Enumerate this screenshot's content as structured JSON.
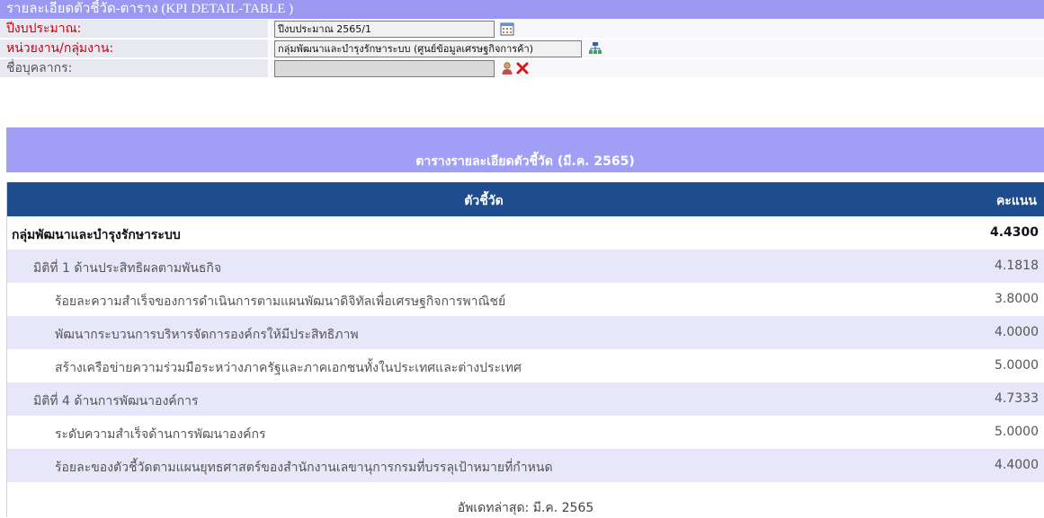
{
  "filter": {
    "title": "รายละเอียดตัวชี้วัด-ตาราง  (KPI DETAIL-TABLE )",
    "budget_year": {
      "label": "ปีงบประมาณ:",
      "value": "ปีงบประมาณ 2565/1",
      "icon": "calendar-icon"
    },
    "department": {
      "label": "หน่วยงาน/กลุ่มงาน:",
      "value": "กลุ่มพัฒนาและบำรุงรักษาระบบ (ศูนย์ข้อมูลเศรษฐกิจการค้า)",
      "icon": "org-chart-icon"
    },
    "person": {
      "label": "ชื่อบุคลากร:",
      "value": "",
      "icons": [
        "person-icon",
        "clear-x-icon"
      ]
    }
  },
  "section_title": "ตารางรายละเอียดตัวชี้วัด (มี.ค. 2565)",
  "table": {
    "columns": [
      "ตัวชี้วัด",
      "คะแนน"
    ],
    "rows": [
      {
        "name": "กลุ่มพัฒนาและบำรุงรักษาระบบ",
        "score": "4.4300"
      },
      {
        "name": "มิติที่ 1 ด้านประสิทธิผลตามพันธกิจ",
        "score": "4.1818"
      },
      {
        "name": "ร้อยละความสำเร็จของการดำเนินการตามแผนพัฒนาดิจิทัลเพื่อเศรษฐกิจการพาณิชย์",
        "score": "3.8000"
      },
      {
        "name": "พัฒนากระบวนการบริหารจัดการองค์กรให้มีประสิทธิภาพ",
        "score": "4.0000"
      },
      {
        "name": "สร้างเครือข่ายความร่วมมือระหว่างภาครัฐและภาคเอกชนทั้งในประเทศและต่างประเทศ",
        "score": "5.0000"
      },
      {
        "name": "มิติที่ 4 ด้านการพัฒนาองค์การ",
        "score": "4.7333"
      },
      {
        "name": "ระดับความสำเร็จด้านการพัฒนาองค์กร",
        "score": "5.0000"
      },
      {
        "name": "ร้อยละของตัวชี้วัดตามแผนยุทธศาสตร์ของสำนักงานเลขานุการกรมที่บรรลุเป้าหมายที่กำหนด",
        "score": "4.4000"
      }
    ]
  },
  "footer": "อัพเดทล่าสุด: มี.ค. 2565",
  "colors": {
    "title_bar": "#9a98f0",
    "section_bar": "#a19ff5",
    "table_header": "#1f4c8c",
    "alt_row": "#e7e7f9",
    "label_red": "#c8000f"
  }
}
